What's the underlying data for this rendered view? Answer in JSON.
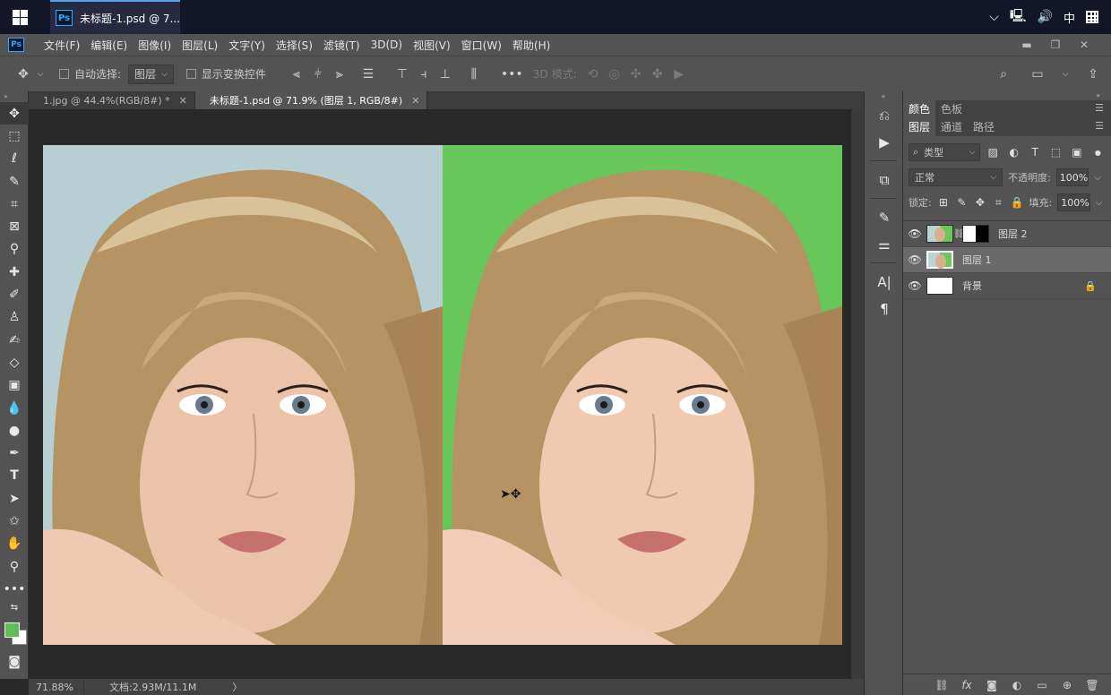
{
  "taskbar": {
    "app_title": "未标题-1.psd @ 7...",
    "app_badge": "Ps",
    "lang": "中"
  },
  "menubar": {
    "logo": "Ps",
    "items": [
      "文件(F)",
      "编辑(E)",
      "图像(I)",
      "图层(L)",
      "文字(Y)",
      "选择(S)",
      "滤镜(T)",
      "3D(D)",
      "视图(V)",
      "窗口(W)",
      "帮助(H)"
    ]
  },
  "options": {
    "auto_select_label": "自动选择:",
    "auto_select_target": "图层",
    "show_transform_label": "显示变换控件",
    "mode_3d_label": "3D 模式:"
  },
  "tabs": [
    {
      "label": "1.jpg @ 44.4%(RGB/8#) *",
      "active": false
    },
    {
      "label": "未标题-1.psd @ 71.9% (图层 1, RGB/8#)",
      "active": true
    }
  ],
  "status": {
    "zoom": "71.88%",
    "doc_info": "文档:2.93M/11.1M"
  },
  "panels": {
    "top_tabs": [
      "颜色",
      "色板"
    ],
    "layer_tabs": [
      "图层",
      "通道",
      "路径"
    ],
    "kind_filter": "类型",
    "blend_mode": "正常",
    "opacity_label": "不透明度:",
    "opacity": "100%",
    "lock_label": "锁定:",
    "fill_label": "填充:",
    "fill": "100%",
    "layers": [
      {
        "name": "图层 2",
        "selected": false,
        "has_mask": true
      },
      {
        "name": "图层 1",
        "selected": true,
        "has_mask": false
      },
      {
        "name": "背景",
        "selected": false,
        "locked": true
      }
    ]
  },
  "colors": {
    "foreground": "#5fbf57",
    "background": "#ffffff",
    "left_bg": "#b7cfd3",
    "right_bg": "#67c75a"
  }
}
